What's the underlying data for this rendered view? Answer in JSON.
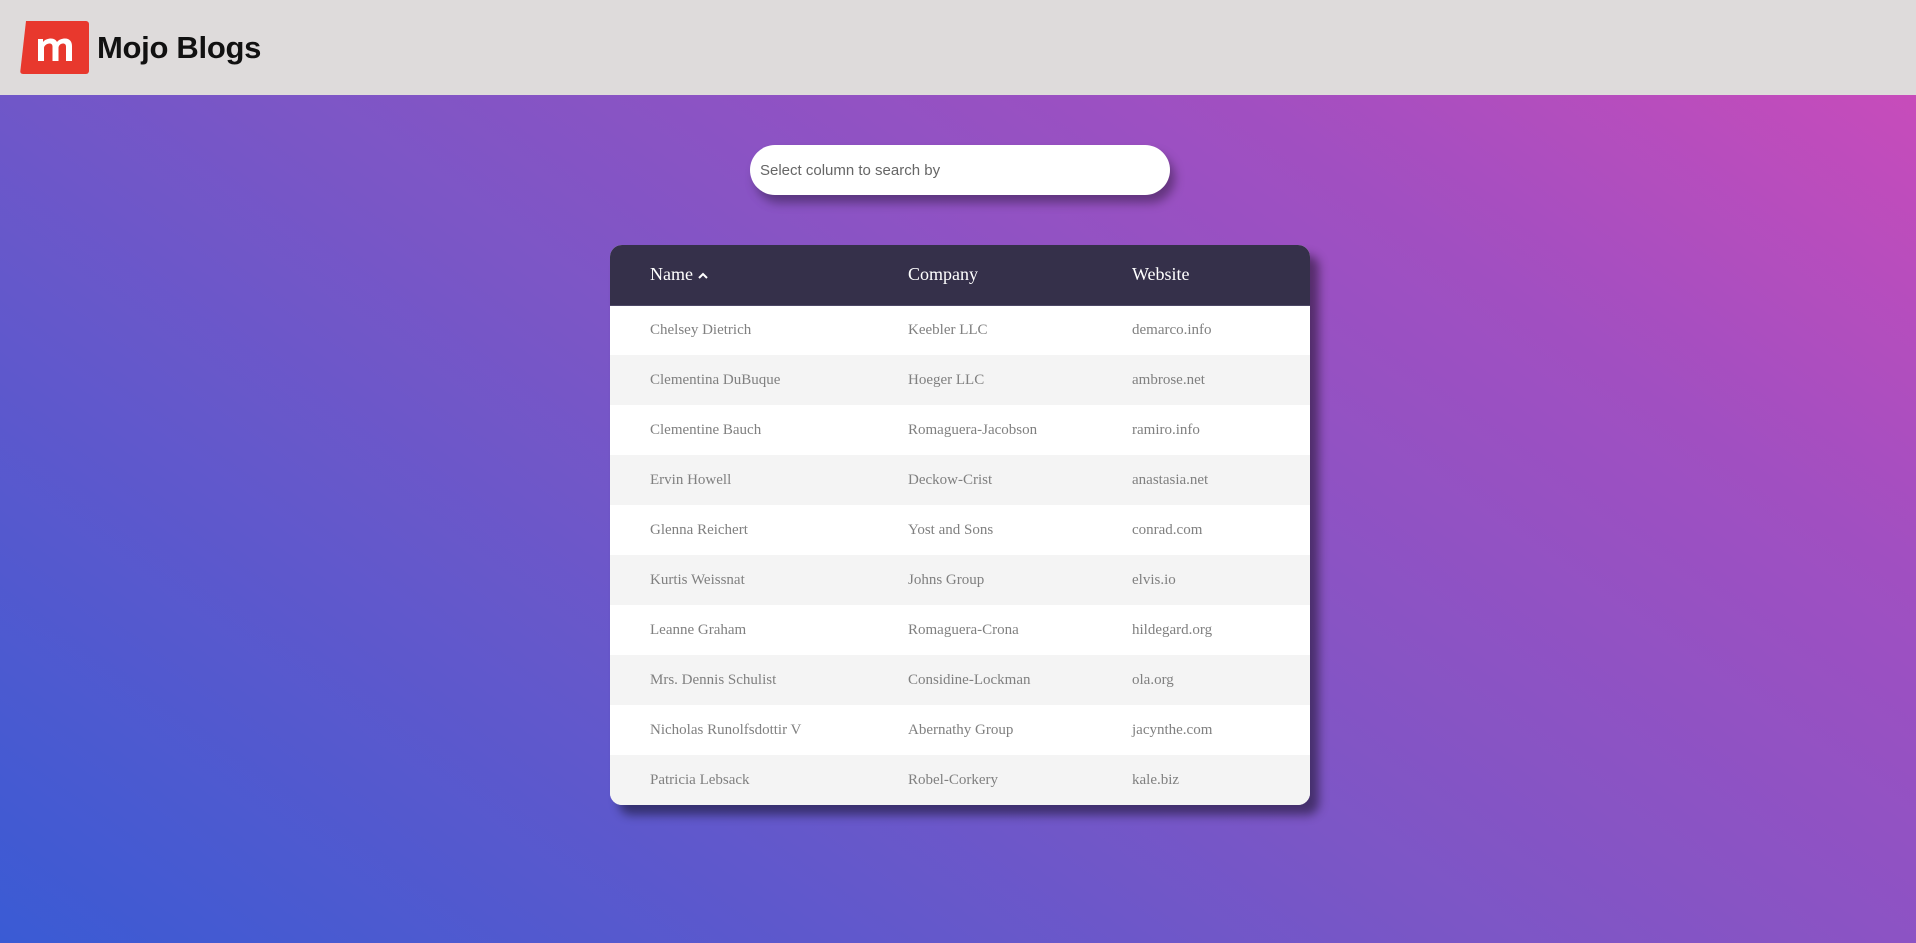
{
  "header": {
    "brand": "Mojo Blogs",
    "logo_letter": "m",
    "logo_color": "#e8382d"
  },
  "search": {
    "placeholder": "Select column to search by"
  },
  "table": {
    "columns": [
      "Name",
      "Company",
      "Website"
    ],
    "sort": {
      "column": "Name",
      "direction": "ascending",
      "icon": "chevron-up-icon"
    },
    "rows": [
      [
        "Chelsey Dietrich",
        "Keebler LLC",
        "demarco.info"
      ],
      [
        "Clementina DuBuque",
        "Hoeger LLC",
        "ambrose.net"
      ],
      [
        "Clementine Bauch",
        "Romaguera-Jacobson",
        "ramiro.info"
      ],
      [
        "Ervin Howell",
        "Deckow-Crist",
        "anastasia.net"
      ],
      [
        "Glenna Reichert",
        "Yost and Sons",
        "conrad.com"
      ],
      [
        "Kurtis Weissnat",
        "Johns Group",
        "elvis.io"
      ],
      [
        "Leanne Graham",
        "Romaguera-Crona",
        "hildegard.org"
      ],
      [
        "Mrs. Dennis Schulist",
        "Considine-Lockman",
        "ola.org"
      ],
      [
        "Nicholas Runolfsdottir V",
        "Abernathy Group",
        "jacynthe.com"
      ],
      [
        "Patricia Lebsack",
        "Robel-Corkery",
        "kale.biz"
      ]
    ]
  },
  "colors": {
    "header_bg": "#dedbdb",
    "table_head_bg": "#35304a",
    "gradient_start": "#3a5bd4",
    "gradient_end": "#cf4bb9"
  }
}
